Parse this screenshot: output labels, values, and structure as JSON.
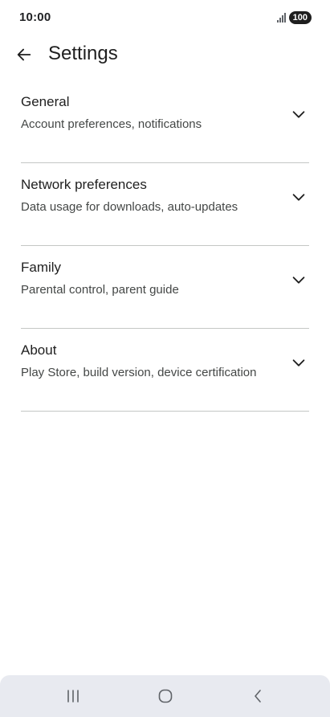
{
  "status_bar": {
    "time": "10:00",
    "battery": "100"
  },
  "header": {
    "title": "Settings",
    "back_icon": "arrow-back-icon"
  },
  "settings": [
    {
      "title": "General",
      "subtitle": "Account preferences, notifications",
      "icon": "chevron-down-icon"
    },
    {
      "title": "Network preferences",
      "subtitle": "Data usage for downloads, auto-updates",
      "icon": "chevron-down-icon"
    },
    {
      "title": "Family",
      "subtitle": "Parental control, parent guide",
      "icon": "chevron-down-icon"
    },
    {
      "title": "About",
      "subtitle": "Play Store, build version, device certification",
      "icon": "chevron-down-icon"
    }
  ],
  "nav_bar": {
    "icons": [
      "recent-apps-icon",
      "home-icon",
      "back-nav-icon"
    ]
  },
  "colors": {
    "text_primary": "#1f1f1f",
    "text_secondary": "#444746",
    "divider": "#c4c7c5",
    "nav_background": "#e8eaf0"
  }
}
